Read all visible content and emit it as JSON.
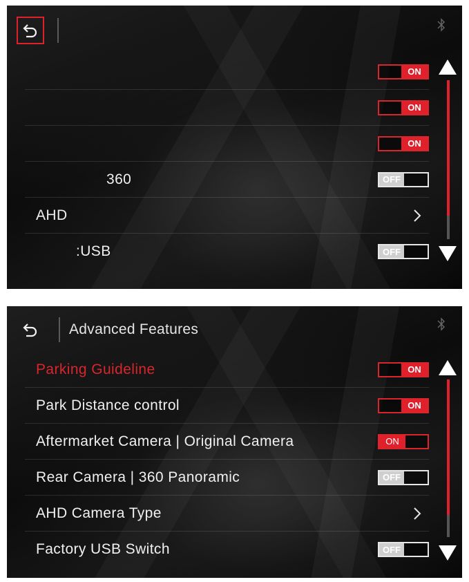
{
  "top_screen": {
    "rows": [
      {
        "label": "",
        "control": "toggle",
        "state": "ON"
      },
      {
        "label": "",
        "control": "toggle",
        "state": "ON"
      },
      {
        "label": "",
        "control": "toggle",
        "state": "ON"
      },
      {
        "label": "360",
        "control": "toggle",
        "state": "OFF"
      },
      {
        "label": "AHD",
        "control": "chevron"
      },
      {
        "label": ":USB",
        "control": "toggle",
        "state": "OFF"
      }
    ]
  },
  "bottom_screen": {
    "title": "Advanced Features",
    "rows": [
      {
        "label": "Parking  Guideline",
        "control": "toggle",
        "state": "ON",
        "active": true
      },
      {
        "label": "Park  Distance  control",
        "control": "toggle",
        "state": "ON"
      },
      {
        "label": "Aftermarket  Camera  |  Original  Camera",
        "control": "toggle",
        "state": "ON"
      },
      {
        "label": "Rear  Camera  |  360  Panoramic",
        "control": "toggle",
        "state": "OFF"
      },
      {
        "label": "AHD  Camera  Type",
        "control": "chevron"
      },
      {
        "label": "Factory  USB  Switch",
        "control": "toggle",
        "state": "OFF"
      }
    ]
  },
  "toggle_on_text": "ON",
  "toggle_off_text": "OFF",
  "icons": {
    "back": "back-arrow-icon",
    "bluetooth": "bluetooth-icon",
    "scroll_up": "triangle-up-icon",
    "scroll_down": "triangle-down-icon",
    "chevron": "chevron-right-icon"
  },
  "colors": {
    "accent": "#e0202a",
    "text": "#f0f0f0",
    "off_knob": "#cfcfcf",
    "background": "#111111"
  }
}
